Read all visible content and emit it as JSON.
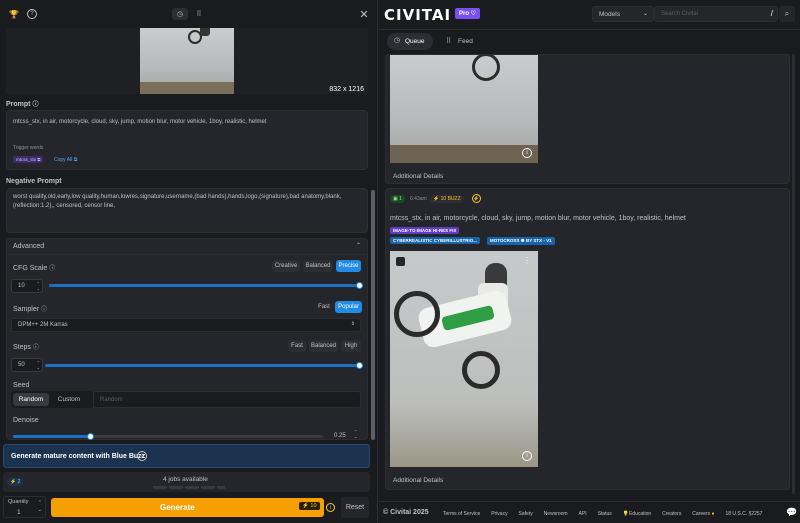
{
  "left": {
    "image_size": "832 x 1216",
    "prompt_label": "Prompt",
    "prompt_text": "mtcss_stx, in air,  motorcycle, cloud, sky, jump, motion blur, motor vehicle, 1boy, realistic, helmet",
    "trigger_words_label": "Trigger words",
    "trigger_chip": "mtcss_stx",
    "copy_all": "Copy All",
    "negative_label": "Negative Prompt",
    "negative_text": "worst quality,old,early,low quality,human,lowres,signature,username,(bad hands),hands,logo,(signature),bad anatomy,blank,(reflection:1.2),, censored, censor line,",
    "advanced_label": "Advanced",
    "cfg_label": "CFG Scale",
    "cfg_presets": [
      "Creative",
      "Balanced",
      "Precise"
    ],
    "cfg_value": "10",
    "cfg_level": 1.0,
    "sampler_label": "Sampler",
    "sampler_tabs": [
      "Fast",
      "Popular"
    ],
    "sampler_value": "DPM++ 2M Karras",
    "steps_label": "Steps",
    "steps_presets": [
      "Fast",
      "Balanced",
      "High"
    ],
    "steps_value": "50",
    "steps_level": 1.0,
    "seed_label": "Seed",
    "seed_tabs": [
      "Random",
      "Custom"
    ],
    "seed_placeholder": "Random",
    "denoise_label": "Denoise",
    "denoise_value": "0.25",
    "denoise_level": 0.25,
    "mature_banner": "Generate mature content with Blue Buzz",
    "buzz_badge": "2",
    "jobs_available": "4 jobs available",
    "quantity_label": "Quantity",
    "quantity_value": "1",
    "generate_label": "Generate",
    "generate_cost": "10",
    "reset_label": "Reset"
  },
  "header": {
    "logo": "CIVITAI",
    "pro_badge": "Pro",
    "models_select": "Models",
    "search_placeholder": "Search Civitai",
    "search_shortcut": "/"
  },
  "right": {
    "tabs": [
      "Queue",
      "Feed"
    ],
    "additional_details_1": "Additional Details",
    "job_count": "1",
    "job_time": "6:43am",
    "job_buzz": "10 BUZZ",
    "job_prompt": "mtcss_stx, in air, motorcycle, cloud, sky, jump, motion blur, motor vehicle, 1boy, realistic, helmet",
    "chip_img2img": "IMAGE-TO-IMAGE HI-RES FIX",
    "chip_model": "CYBERREALISTIC CYBERILLUSTRIO...",
    "chip_lora": "MOTOCROSS ☸ BY STX - V1",
    "additional_details_2": "Additional Details"
  },
  "footer": {
    "copyright": "© Civitai 2025",
    "links": [
      "Terms of Service",
      "Privacy",
      "Safety",
      "Newsroom",
      "API",
      "Status",
      "Education",
      "Creators",
      "Careers",
      "18 U.S.C. §2257"
    ]
  },
  "colors": {
    "accent": "#228be6",
    "generate": "#f59f00",
    "pro": "#7950f2"
  }
}
